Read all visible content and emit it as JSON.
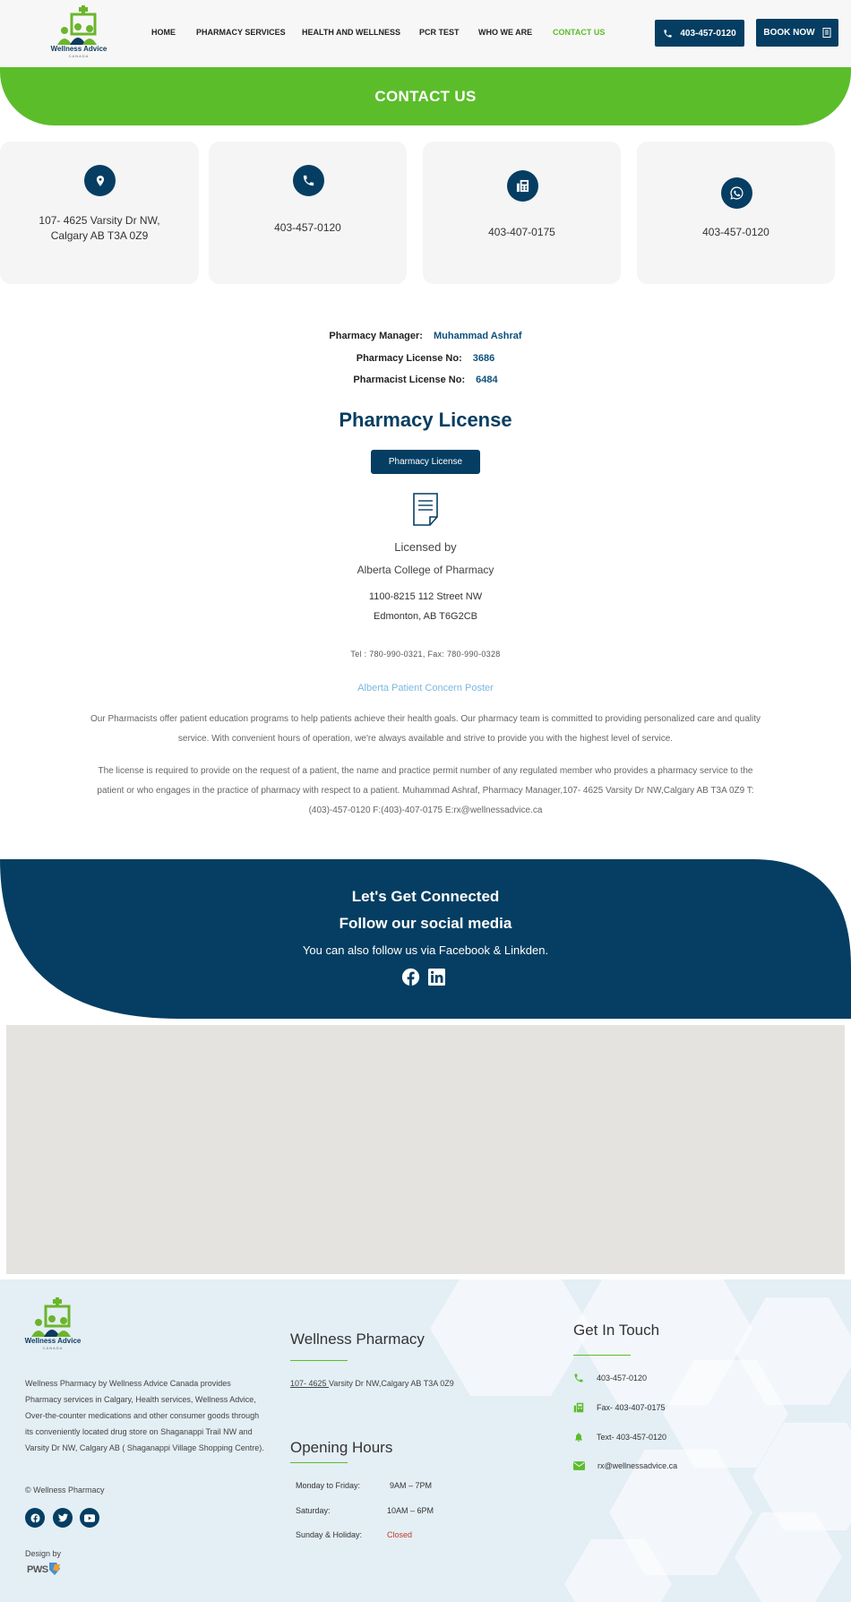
{
  "header": {
    "logo_text": "Wellness Advice",
    "logo_sub": "CANADA",
    "nav": [
      "HOME",
      "PHARMACY SERVICES",
      "HEALTH AND WELLNESS",
      "PCR TEST",
      "WHO WE ARE",
      "CONTACT US"
    ],
    "active_nav": "CONTACT US",
    "phone_button": "403-457-0120",
    "book_button": "BOOK NOW"
  },
  "hero": {
    "title": "CONTACT US"
  },
  "cards": [
    {
      "icon": "location-pin-icon",
      "line1": "107- 4625 Varsity Dr NW,",
      "line2": "Calgary AB T3A 0Z9"
    },
    {
      "icon": "phone-icon",
      "line1": "403-457-0120",
      "line2": ""
    },
    {
      "icon": "fax-icon",
      "line1": "403-407-0175",
      "line2": ""
    },
    {
      "icon": "whatsapp-icon",
      "line1": "403-457-0120",
      "line2": ""
    }
  ],
  "license_info": {
    "manager_label": "Pharmacy Manager:",
    "manager_value": "Muhammad Ashraf",
    "license_label": "Pharmacy License No:",
    "license_value": "3686",
    "pharmacist_label": "Pharmacist License No:",
    "pharmacist_value": "6484"
  },
  "pharmacy_license": {
    "title": "Pharmacy License",
    "button": "Pharmacy License",
    "licensed_by": "Licensed by",
    "college": "Alberta College of Pharmacy",
    "address1": "1100-8215 112 Street NW",
    "address2": "Edmonton, AB T6G2CB",
    "tel_fax": "Tel : 780-990-0321, Fax: 780-990-0328",
    "poster_link": "Alberta Patient Concern Poster",
    "para1": "Our Pharmacists offer patient education programs to help patients achieve their health goals. Our pharmacy team is committed to providing personalized care and quality service. With convenient hours of operation, we're always available and strive to provide you with the highest level of service.",
    "para2": "The license is required to provide on the request of a patient, the name and practice permit number of any regulated member who provides a pharmacy service to the patient or who engages in the practice of pharmacy with respect to a patient. Muhammad Ashraf, Pharmacy Manager,107- 4625 Varsity Dr NW,Calgary AB T3A 0Z9 T:(403)-457-0120 F:(403)-407-0175 E:rx@wellnessadvice.ca"
  },
  "social": {
    "title1": "Let's Get Connected",
    "title2": "Follow our social media",
    "subtitle": "You can also follow us via Facebook & Linkden."
  },
  "footer": {
    "about": "Wellness Pharmacy by Wellness Advice Canada provides Pharmacy services in Calgary, Health services, Wellness Advice, Over-the-counter medications and other consumer goods through its conveniently located drug store on Shaganappi Trail NW and Varsity Dr NW, Calgary AB ( Shaganappi Village Shopping Centre).",
    "copyright": "© Wellness Pharmacy",
    "design_by": "Design by",
    "design_logo": "PWS",
    "wp_title": "Wellness Pharmacy",
    "wp_address_link": "107- 4625 ",
    "wp_address_rest": "Varsity Dr NW,Calgary AB T3A 0Z9",
    "hours_title": "Opening Hours",
    "hours": [
      {
        "day": "Monday to Friday:",
        "time": "9AM – 7PM"
      },
      {
        "day": "Saturday:",
        "time": "10AM – 6PM"
      },
      {
        "day": "Sunday & Holiday:",
        "time": "Closed"
      }
    ],
    "contact_title": "Get In Touch",
    "contacts": [
      {
        "icon": "phone-icon",
        "text": "403-457-0120"
      },
      {
        "icon": "fax-icon",
        "text": "Fax- 403-407-0175"
      },
      {
        "icon": "bell-icon",
        "text": "Text- 403-457-0120"
      },
      {
        "icon": "mail-icon",
        "text": "rx@wellnessadvice.ca"
      }
    ]
  },
  "colors": {
    "navy": "#053e62",
    "green": "#5bbd2a",
    "closed": "#c0392b",
    "link": "#7ab8e0"
  }
}
